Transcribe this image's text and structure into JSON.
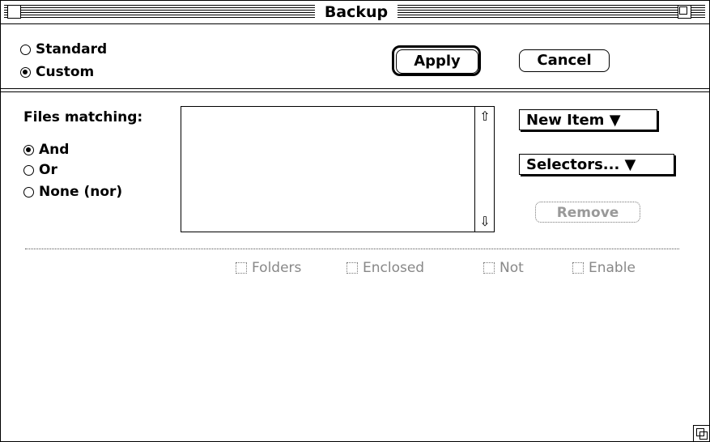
{
  "window": {
    "title": "Backup"
  },
  "mode": {
    "options": [
      {
        "label": "Standard",
        "selected": false
      },
      {
        "label": "Custom",
        "selected": true
      }
    ]
  },
  "buttons": {
    "apply": "Apply",
    "cancel": "Cancel"
  },
  "filter": {
    "label": "Files matching:",
    "options": [
      {
        "label": "And",
        "selected": true
      },
      {
        "label": "Or",
        "selected": false
      },
      {
        "label": "None (nor)",
        "selected": false
      }
    ]
  },
  "actions": {
    "new_item": "New Item ▼",
    "selectors": "Selectors... ▼",
    "remove": "Remove"
  },
  "checkboxes": [
    {
      "label": "Folders",
      "checked": false,
      "enabled": false
    },
    {
      "label": "Enclosed",
      "checked": false,
      "enabled": false
    },
    {
      "label": "Not",
      "checked": false,
      "enabled": false
    },
    {
      "label": "Enable",
      "checked": false,
      "enabled": false
    }
  ],
  "icons": {
    "scroll_up": "up-arrow-icon",
    "scroll_down": "down-arrow-icon"
  }
}
